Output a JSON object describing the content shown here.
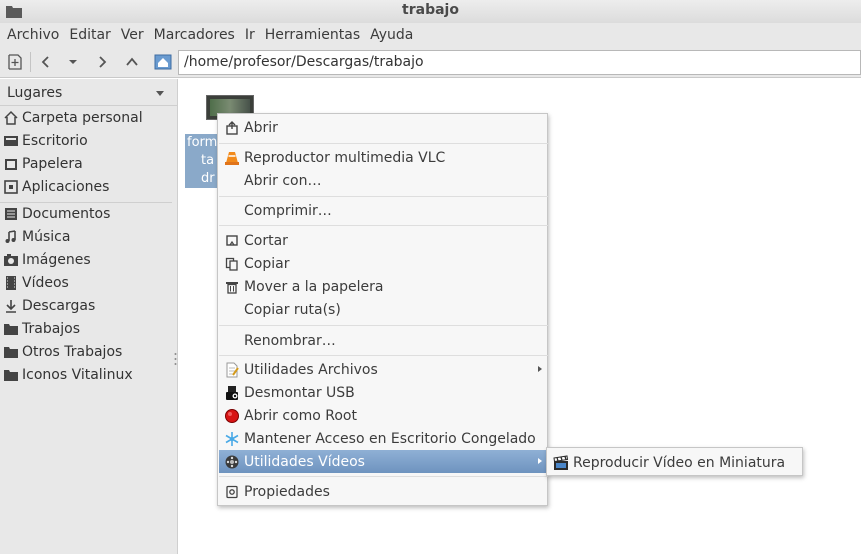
{
  "window": {
    "title": "trabajo"
  },
  "menubar": [
    "Archivo",
    "Editar",
    "Ver",
    "Marcadores",
    "Ir",
    "Herramientas",
    "Ayuda"
  ],
  "toolbar": {
    "buttons": [
      "new-tab-icon",
      "back-icon",
      "history-dropdown-icon",
      "forward-icon",
      "up-icon",
      "home-icon"
    ],
    "location": "/home/profesor/Descargas/trabajo"
  },
  "sidebar": {
    "header": "Lugares",
    "items": [
      {
        "label": "Carpeta personal",
        "icon": "home-icon"
      },
      {
        "label": "Escritorio",
        "icon": "desktop-icon"
      },
      {
        "label": "Papelera",
        "icon": "trash-icon"
      },
      {
        "label": "Aplicaciones",
        "icon": "applications-icon"
      },
      {
        "label": "Documentos",
        "icon": "documents-icon"
      },
      {
        "label": "Música",
        "icon": "music-icon"
      },
      {
        "label": "Imágenes",
        "icon": "pictures-icon"
      },
      {
        "label": "Vídeos",
        "icon": "videos-icon"
      },
      {
        "label": "Descargas",
        "icon": "downloads-icon"
      },
      {
        "label": "Trabajos",
        "icon": "folder-icon"
      },
      {
        "label": "Otros Trabajos",
        "icon": "folder-icon"
      },
      {
        "label": "Iconos Vitalinux",
        "icon": "folder-icon"
      }
    ]
  },
  "file": {
    "label_lines": [
      "form",
      "ta",
      "dr"
    ]
  },
  "context_menu": {
    "items": [
      {
        "label": "Abrir",
        "icon": "open-icon"
      },
      {
        "label": "Reproductor multimedia VLC",
        "icon": "vlc-icon"
      },
      {
        "label": "Abrir con…",
        "icon": ""
      },
      {
        "label": "Comprimir…",
        "icon": ""
      },
      {
        "label": "Cortar",
        "icon": "cut-icon"
      },
      {
        "label": "Copiar",
        "icon": "copy-icon"
      },
      {
        "label": "Mover a la papelera",
        "icon": "trash-icon"
      },
      {
        "label": "Copiar ruta(s)",
        "icon": ""
      },
      {
        "label": "Renombrar…",
        "icon": ""
      },
      {
        "label": "Utilidades Archivos",
        "icon": "file-utilities-icon",
        "submenu": true
      },
      {
        "label": "Desmontar USB",
        "icon": "usb-icon"
      },
      {
        "label": "Abrir como Root",
        "icon": "root-icon"
      },
      {
        "label": "Mantener Acceso en Escritorio Congelado",
        "icon": "snowflake-icon"
      },
      {
        "label": "Utilidades Vídeos",
        "icon": "video-utilities-icon",
        "submenu": true,
        "active": true
      },
      {
        "label": "Propiedades",
        "icon": "properties-icon"
      }
    ]
  },
  "submenu": {
    "items": [
      {
        "label": "Reproducir Vídeo en Miniatura",
        "icon": "clapperboard-icon"
      }
    ]
  },
  "colors": {
    "selection": "#7298c4",
    "sidebar_bg": "#e8e8e8",
    "menu_bg": "#f7f7f7"
  }
}
